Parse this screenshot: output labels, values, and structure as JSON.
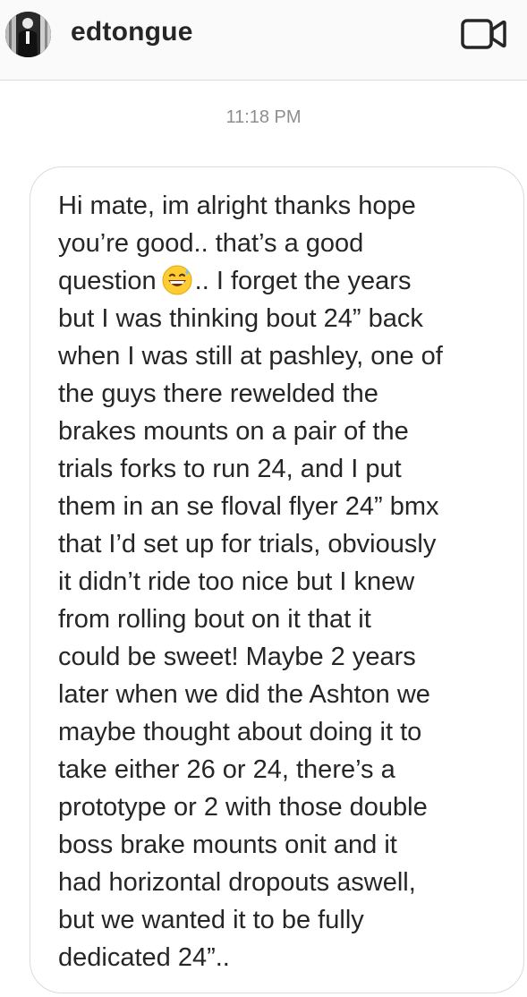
{
  "header": {
    "username": "edtongue",
    "avatar_icon": "profile-photo",
    "video_icon": "video-camera-icon"
  },
  "thread": {
    "timestamp": "11:18 PM"
  },
  "message": {
    "lines": [
      "Hi mate, im alright thanks hope",
      "you’re good.. that’s a good",
      ".. I forget the years",
      "but I was thinking bout 24” back",
      "when I was still at pashley, one of",
      "the guys there rewelded the",
      "brakes mounts on a pair of the",
      "trials forks to run 24, and I put",
      "them in an se floval flyer 24” bmx",
      "that I’d set up for trials, obviously",
      "it didn’t ride too nice but I knew",
      "from rolling bout on it that it",
      "could be sweet! Maybe 2 years",
      "later when we did the Ashton we",
      "maybe thought about doing it to",
      "take either 26 or 24, there’s a",
      "prototype or 2 with those double",
      "boss brake mounts onit and it",
      "had horizontal dropouts aswell,",
      "but we wanted it to be fully",
      "dedicated 24”.."
    ],
    "line3_prefix": "question",
    "emoji": "😅",
    "emoji_icon": "grinning-sweat-emoji"
  },
  "colors": {
    "text": "#262626",
    "muted": "#8e8e8e",
    "border": "#dbdbdb",
    "header_bg": "#fafafa"
  }
}
